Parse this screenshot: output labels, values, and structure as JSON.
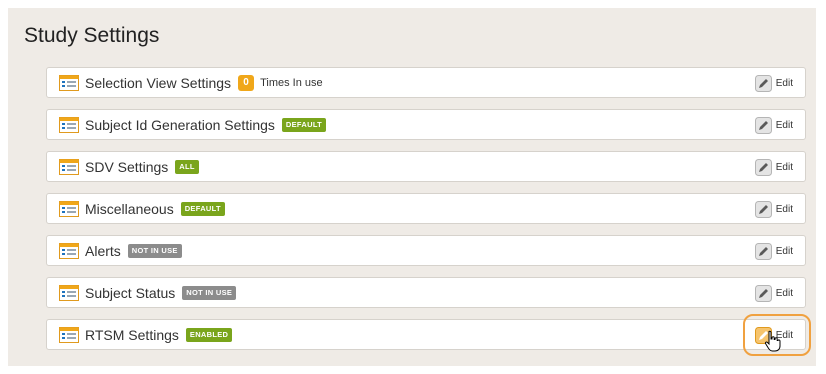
{
  "page": {
    "title": "Study Settings"
  },
  "edit_label": "Edit",
  "colors": {
    "accent_orange": "#f0a140",
    "badge_green": "#7aa51c",
    "badge_gray": "#8c8c8c",
    "count_orange": "#f0a71a"
  },
  "rows": [
    {
      "label": "Selection View Settings",
      "count": "0",
      "count_text": "Times In use"
    },
    {
      "label": "Subject Id Generation Settings",
      "badge": "DEFAULT",
      "badge_color": "green"
    },
    {
      "label": "SDV Settings",
      "badge": "ALL",
      "badge_color": "green"
    },
    {
      "label": "Miscellaneous",
      "badge": "DEFAULT",
      "badge_color": "green"
    },
    {
      "label": "Alerts",
      "badge": "NOT IN USE",
      "badge_color": "gray"
    },
    {
      "label": "Subject Status",
      "badge": "NOT IN USE",
      "badge_color": "gray"
    },
    {
      "label": "RTSM Settings",
      "badge": "ENABLED",
      "badge_color": "green",
      "edit_highlighted": true
    }
  ]
}
